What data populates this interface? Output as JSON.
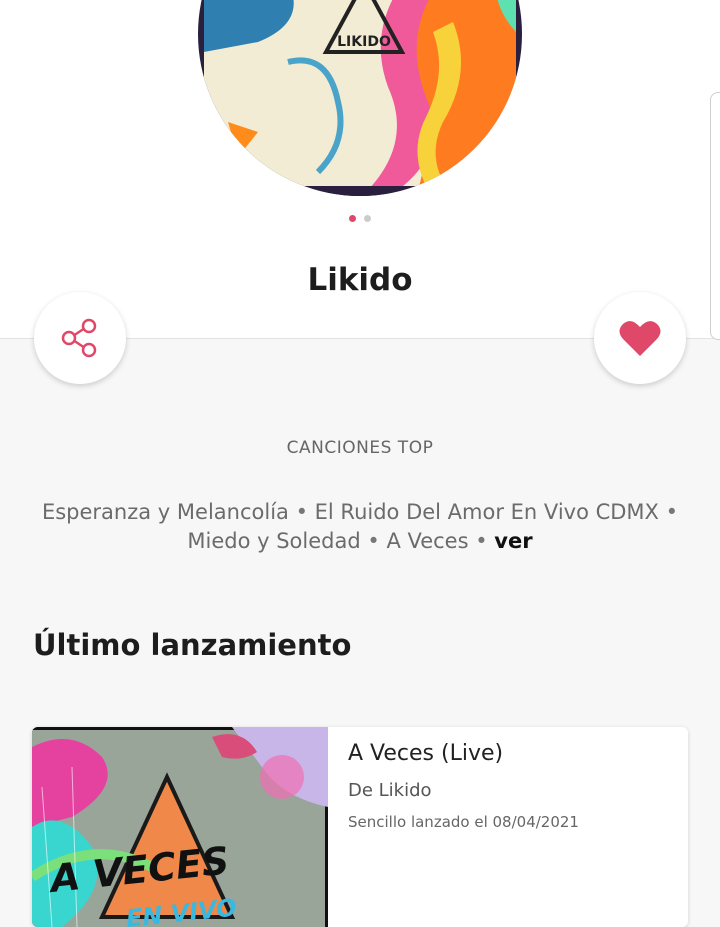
{
  "artist": {
    "name": "Likido",
    "logo_text": "LIKIDO"
  },
  "pager": {
    "count": 2,
    "active": 1
  },
  "actions": {
    "share_icon": "share-icon",
    "favorite_icon": "heart-icon",
    "favorite_color": "#e0486a"
  },
  "top_songs": {
    "heading": "CANCIONES TOP",
    "songs": [
      "Esperanza y Melancolía",
      "El Ruido Del Amor En Vivo CDMX",
      "Miedo y Soledad",
      "A Veces"
    ],
    "separator": " • ",
    "more_label": "ver"
  },
  "latest": {
    "heading": "Último lanzamiento",
    "title": "A Veces (Live)",
    "artist_line": "De Likido",
    "release_line": "Sencillo lanzado el 08/04/2021",
    "art_text_main": "A VECES",
    "art_text_sub": "EN VIVO"
  },
  "colors": {
    "accent": "#e0486a",
    "background": "#f7f7f7"
  }
}
